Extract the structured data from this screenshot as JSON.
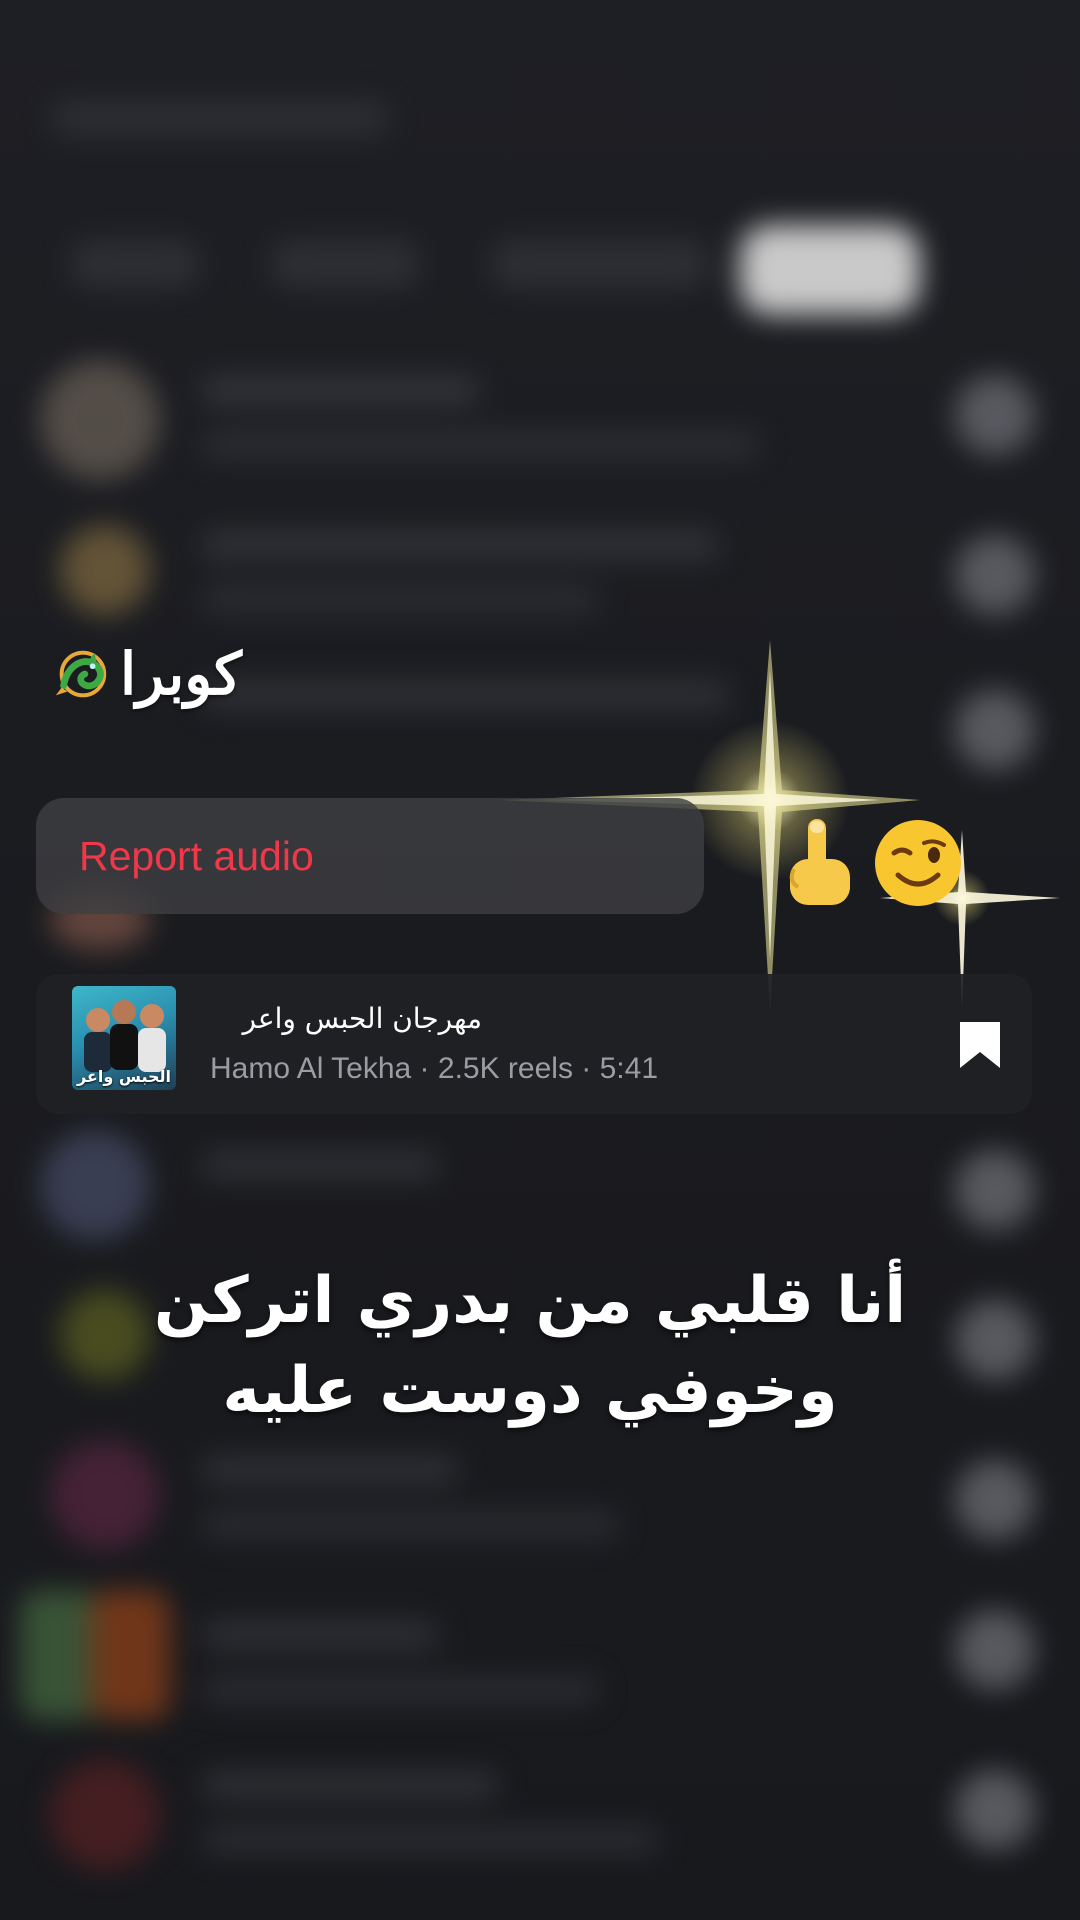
{
  "caption": {
    "text": "كوبرا",
    "icon": "dragon-icon"
  },
  "menu": {
    "report_audio_label": "Report audio",
    "report_color": "#f0384a"
  },
  "audio": {
    "title": "مهرجان الحبس واعر",
    "cover_title": "الحبس واعر",
    "meta": "Hamo Al Tekha · 2.5K reels · 5:41",
    "bookmark_icon": "bookmark-icon"
  },
  "lyrics": {
    "line1": "أنا قلبي من بدري اتركن",
    "line2": "وخوفي دوست عليه"
  },
  "emojis": {
    "finger": "pointing-up-icon",
    "face": "winking-face-icon"
  },
  "colors": {
    "background": "#1b1c20",
    "card": "#202125",
    "sparkle": "#f3ec9a"
  }
}
